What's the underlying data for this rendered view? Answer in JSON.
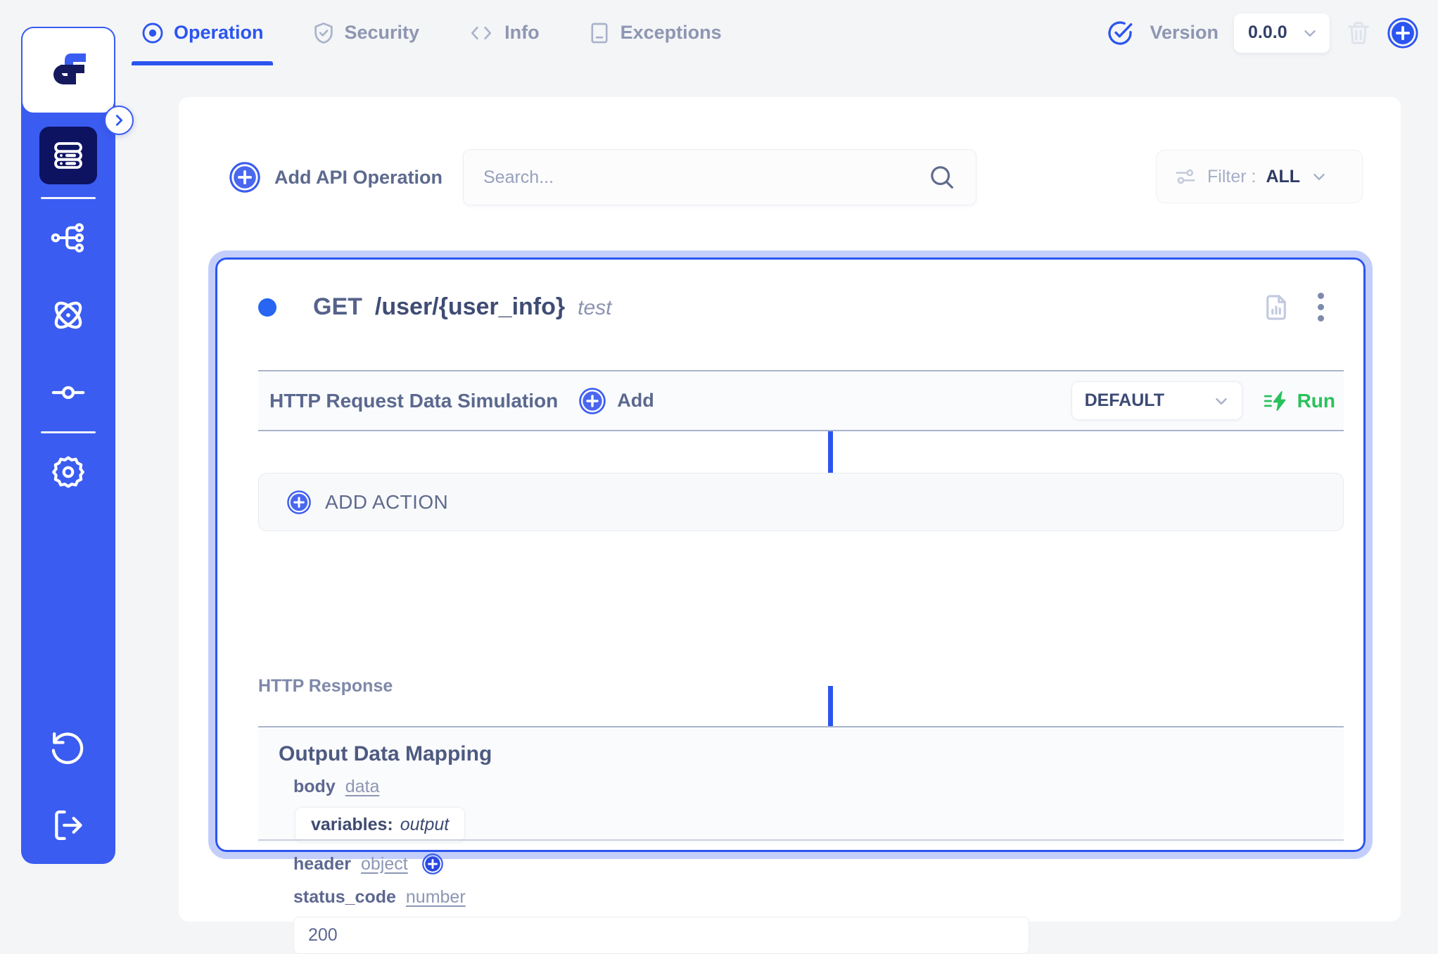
{
  "app": {
    "logo_icon": "brand-logo-icon",
    "sidebar": {
      "expand_icon": "chevron-right-icon",
      "items": [
        {
          "icon": "database-stack-icon",
          "name": "api-catalog",
          "active": true
        },
        {
          "icon": "sitemap-branch-icon",
          "name": "workflow"
        },
        {
          "icon": "atom-icon",
          "name": "integrations"
        },
        {
          "icon": "node-connector-icon",
          "name": "pipelines"
        },
        {
          "icon": "gear-icon",
          "name": "settings"
        },
        {
          "icon": "history-undo-icon",
          "name": "history"
        },
        {
          "icon": "logout-icon",
          "name": "logout"
        }
      ]
    }
  },
  "tabs": [
    {
      "label": "Operation",
      "icon": "target-dot-icon",
      "active": true
    },
    {
      "label": "Security",
      "icon": "shield-check-icon",
      "active": false
    },
    {
      "label": "Info",
      "icon": "code-brackets-icon",
      "active": false
    },
    {
      "label": "Exceptions",
      "icon": "document-warning-icon",
      "active": false
    }
  ],
  "version": {
    "icon": "check-circle-icon",
    "label": "Version",
    "value": "0.0.0",
    "chevron": "chevron-down-icon",
    "delete_icon": "trash-icon",
    "add_icon": "plus-circle-icon"
  },
  "toolbar": {
    "add_operation_label": "Add API Operation",
    "add_operation_icon": "plus-circle-icon",
    "search_placeholder": "Search...",
    "search_value": "",
    "search_icon": "search-icon",
    "filter_icon": "filter-sliders-icon",
    "filter_label": "Filter :",
    "filter_value": "ALL",
    "filter_chevron": "chevron-down-icon"
  },
  "operation": {
    "status_dot": "status-dot-active",
    "method": "GET",
    "path": "/user/{user_info}",
    "name": "test",
    "report_icon": "file-chart-icon",
    "menu_icon": "kebab-menu-icon",
    "simulation": {
      "title": "HTTP Request Data Simulation",
      "add_icon": "plus-circle-icon",
      "add_label": "Add",
      "env_value": "DEFAULT",
      "env_chevron": "chevron-down-icon",
      "run_icon": "lightning-run-icon",
      "run_label": "Run"
    },
    "add_action": {
      "icon": "plus-circle-icon",
      "label": "ADD ACTION"
    },
    "response": {
      "section_label": "HTTP Response",
      "mapping_title": "Output Data Mapping",
      "fields": [
        {
          "key": "body",
          "type": "data"
        },
        {
          "key": "header",
          "type": "object",
          "add_icon": "plus-circle-icon"
        },
        {
          "key": "status_code",
          "type": "number"
        }
      ],
      "variable_chip": {
        "key": "variables:",
        "value": "output"
      },
      "status_code_value": "200"
    }
  },
  "colors": {
    "brand_blue": "#2b55f0",
    "sidebar_blue": "#3a5cf0",
    "active_tile": "#0d1261",
    "run_green": "#2ac15c",
    "muted_text": "#8d96b2",
    "page_bg": "#f4f5f7"
  }
}
